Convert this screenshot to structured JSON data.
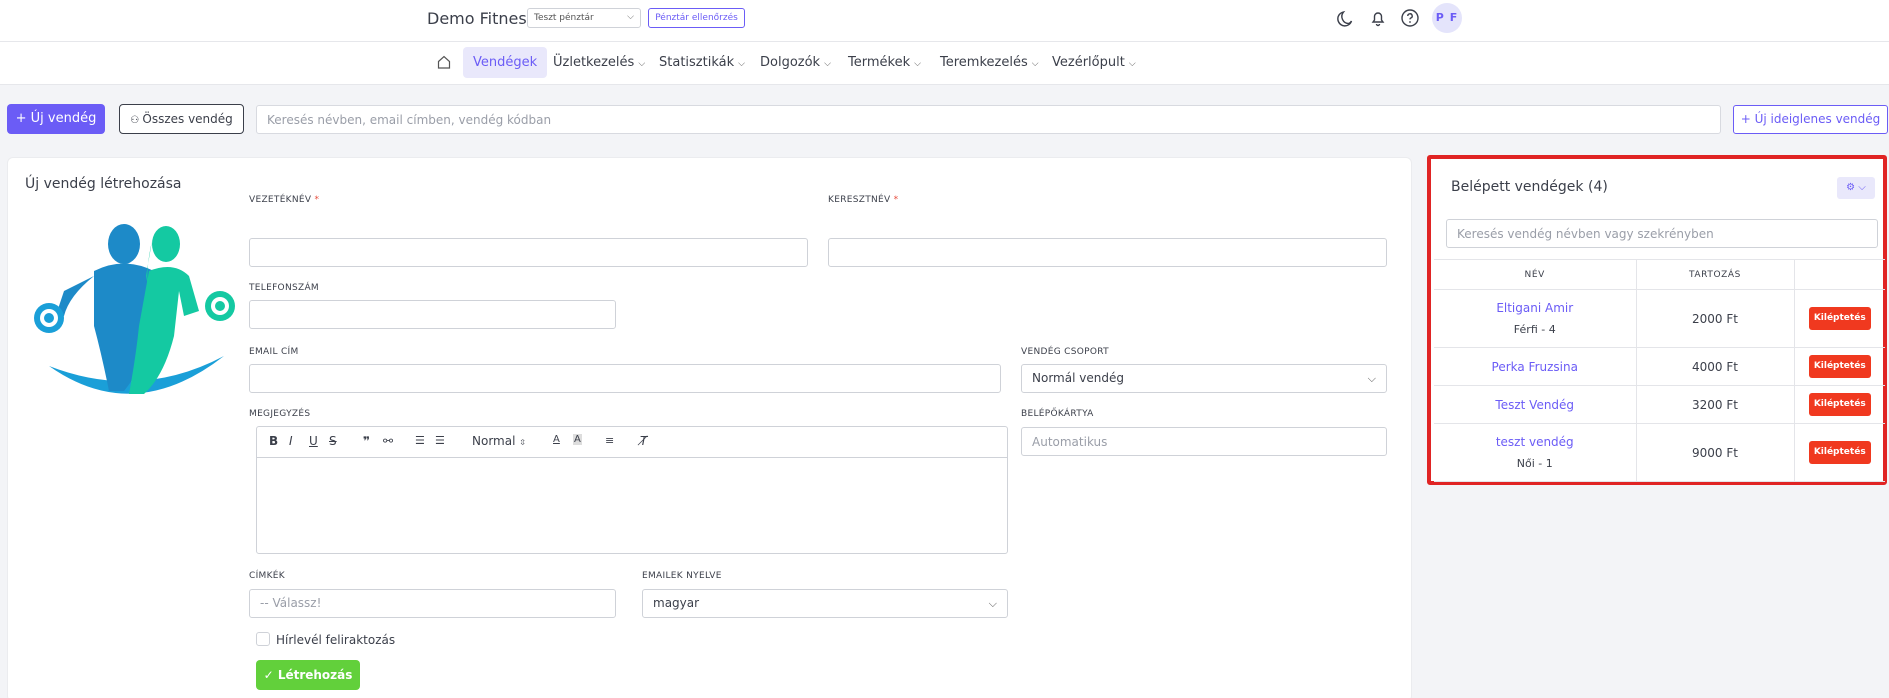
{
  "topbar": {
    "brand": "Demo Fitness",
    "register_select": "Teszt pénztár",
    "register_check_label": "Pénztár ellenőrzés",
    "avatar_initials": "P F"
  },
  "nav": {
    "items": [
      {
        "label": "Vendégek",
        "active": true
      },
      {
        "label": "Üzletkezelés"
      },
      {
        "label": "Statisztikák"
      },
      {
        "label": "Dolgozók"
      },
      {
        "label": "Termékek"
      },
      {
        "label": "Teremkezelés"
      },
      {
        "label": "Vezérlőpult"
      }
    ]
  },
  "toolbar": {
    "new_guest": "Új vendég",
    "all_guests": "Összes vendég",
    "search_placeholder": "Keresés névben, email címben, vendég kódban",
    "new_temp_guest": "Új ideiglenes vendég"
  },
  "form": {
    "title": "Új vendég létrehozása",
    "last_name_label": "Vezetéknév",
    "first_name_label": "Keresztnév",
    "phone_label": "Telefonszám",
    "email_label": "Email cím",
    "group_label": "Vendég csoport",
    "group_value": "Normál vendég",
    "note_label": "Megjegyzés",
    "card_label": "Belépőkártya",
    "card_placeholder": "Automatikus",
    "editor_format": "Normal",
    "tags_label": "Címkék",
    "tags_placeholder": "-- Válassz!",
    "email_lang_label": "Emailek nyelve",
    "email_lang_value": "magyar",
    "newsletter_label": "Hírlevél feliraktozás",
    "submit_label": "Létrehozás"
  },
  "guests": {
    "title": "Belépett vendégek (4)",
    "search_placeholder": "Keresés vendég névben vagy szekrényben",
    "col_name": "Név",
    "col_debt": "Tartozás",
    "checkout_label": "Kiléptetés",
    "rows": [
      {
        "name": "Eltigani Amir",
        "sub": "Férfi - 4",
        "debt": "2000 Ft"
      },
      {
        "name": "Perka Fruzsina",
        "sub": "",
        "debt": "4000 Ft"
      },
      {
        "name": "Teszt Vendég",
        "sub": "",
        "debt": "3200 Ft"
      },
      {
        "name": "teszt vendég",
        "sub": "Női - 1",
        "debt": "9000 Ft"
      }
    ]
  },
  "colors": {
    "accent": "#6b5cf6",
    "danger": "#f0391f",
    "success": "#62d03b",
    "highlight_border": "#e02424"
  }
}
